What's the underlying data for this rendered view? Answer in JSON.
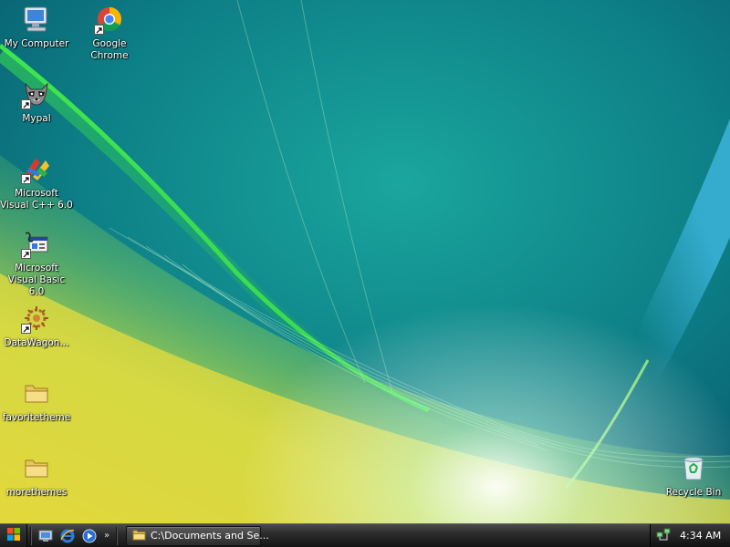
{
  "desktop": {
    "icons": [
      {
        "label": "My Computer",
        "icon": "my-computer-icon",
        "shortcut": false
      },
      {
        "label": "Google Chrome",
        "icon": "chrome-icon",
        "shortcut": true
      },
      {
        "label": "Mypal",
        "icon": "mypal-raccoon-icon",
        "shortcut": true
      },
      {
        "label": "Microsoft Visual C++ 6.0",
        "icon": "visual-cpp-icon",
        "shortcut": true
      },
      {
        "label": "Microsoft Visual Basic 6.0",
        "icon": "visual-basic-icon",
        "shortcut": true
      },
      {
        "label": "DataWagon...",
        "icon": "datawagon-icon",
        "shortcut": true
      },
      {
        "label": "favoritetheme",
        "icon": "folder-icon",
        "shortcut": false
      },
      {
        "label": "morethemes",
        "icon": "folder-icon",
        "shortcut": false
      },
      {
        "label": "Recycle Bin",
        "icon": "recycle-bin-icon",
        "shortcut": false
      }
    ]
  },
  "taskbar": {
    "start_icon": "windows-logo-icon",
    "quick_launch": [
      "show-desktop-icon",
      "internet-explorer-icon",
      "media-player-icon"
    ],
    "quick_launch_more": "»",
    "task_button": {
      "icon": "folder-icon",
      "label": "C:\\Documents and Se..."
    },
    "tray_icon": "network-icon",
    "clock": "4:34 AM"
  },
  "colors": {
    "wallpaper_teal": "#0f7d82",
    "wallpaper_green": "#3dd93a",
    "wallpaper_yellow": "#e3e043",
    "taskbar_dark": "#1c1c1c"
  }
}
